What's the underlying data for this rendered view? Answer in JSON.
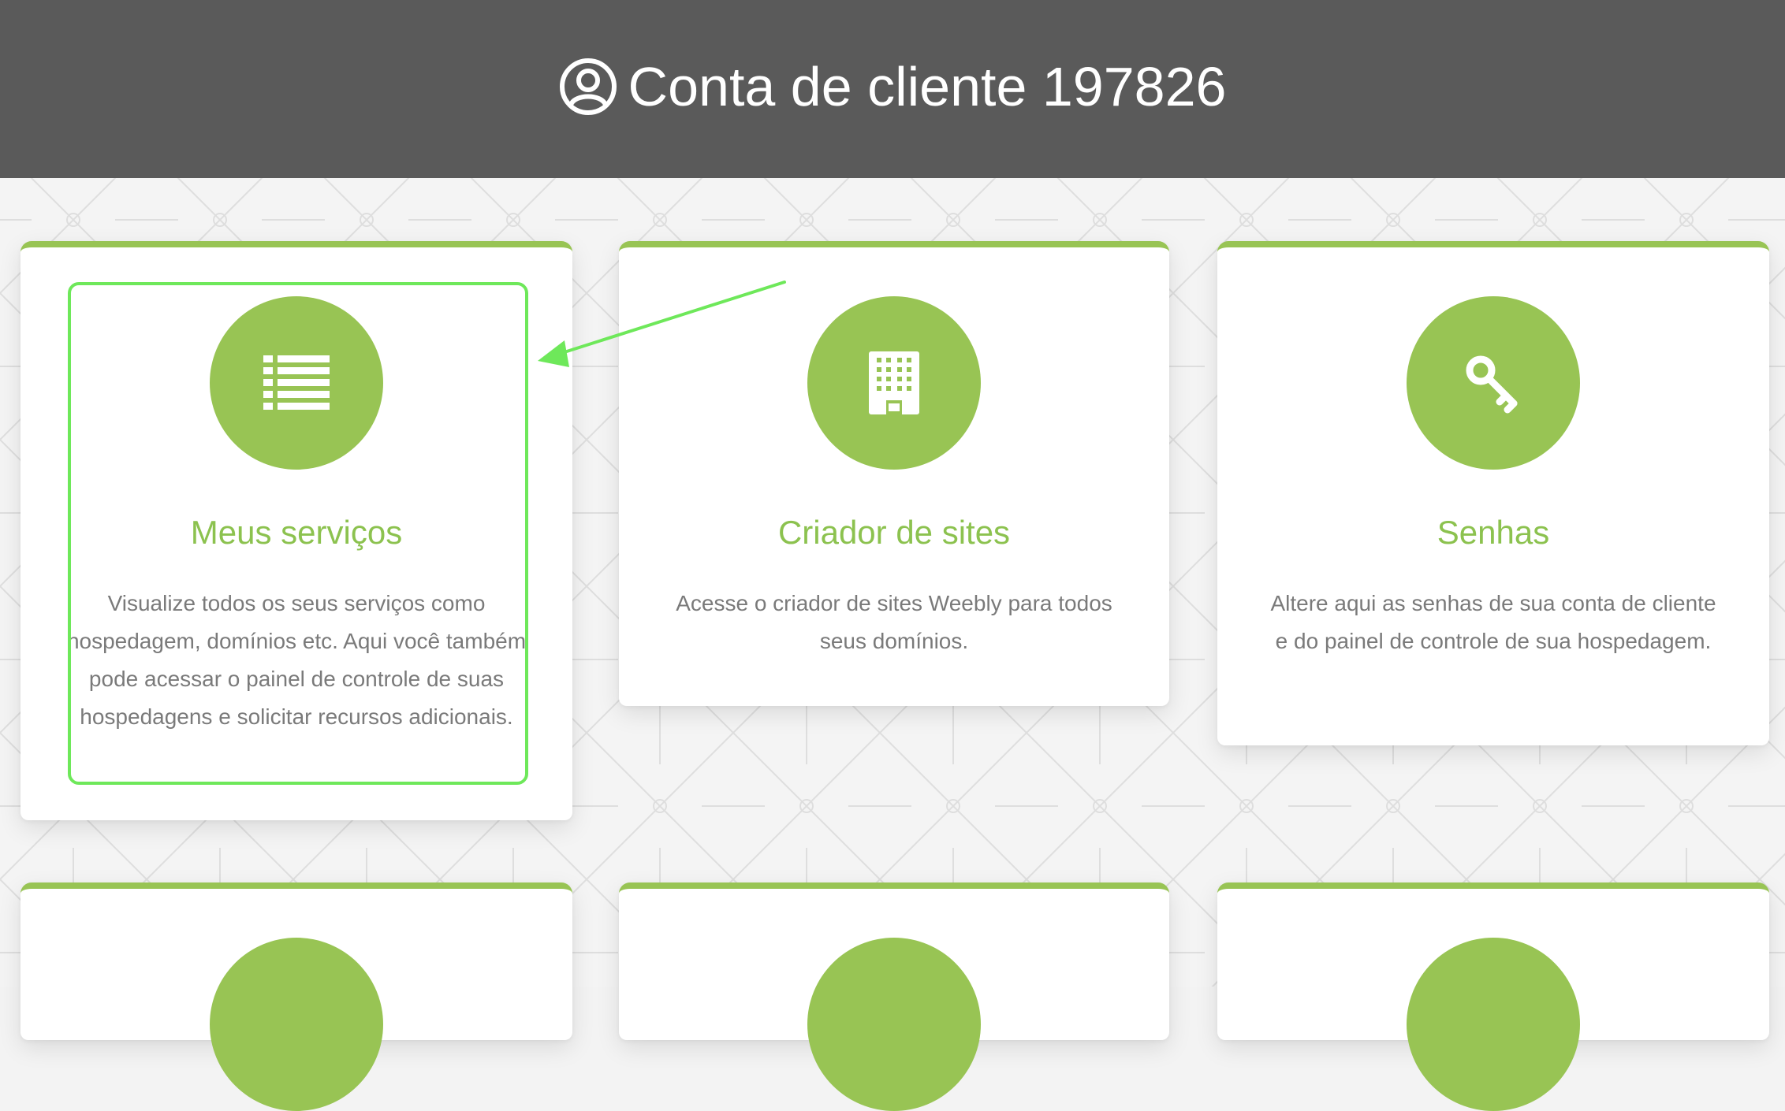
{
  "header": {
    "title": "Conta de cliente 197826",
    "icon": "user-circle-icon",
    "background": "#5a5a5a"
  },
  "theme": {
    "accent": "#98c454",
    "highlight": "#6ee85a",
    "text_muted": "#7a7a7a"
  },
  "cards": [
    {
      "title": "Meus serviços",
      "icon": "list-icon",
      "description": "Visualize todos os seus serviços como hospedagem, domínios etc. Aqui você também pode acessar o painel de controle de suas hospedagens e solicitar recursos adicionais."
    },
    {
      "title": "Criador de sites",
      "icon": "building-icon",
      "description": "Acesse o criador de sites Weebly para todos seus domínios."
    },
    {
      "title": "Senhas",
      "icon": "key-icon",
      "description": "Altere aqui as senhas de sua conta de cliente e do painel de controle de sua hospedagem."
    }
  ],
  "annotation": {
    "type": "arrow-and-box",
    "target": "Meus serviços"
  }
}
